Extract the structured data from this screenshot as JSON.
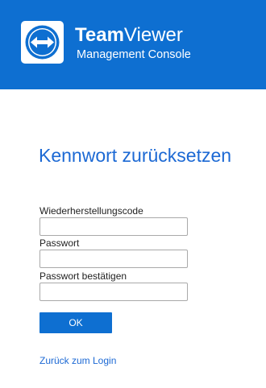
{
  "header": {
    "brand_bold": "Team",
    "brand_regular": "Viewer",
    "subtitle": "Management Console",
    "logo_icon": "teamviewer-arrows-icon",
    "background_color": "#0e6fd1"
  },
  "page": {
    "title": "Kennwort zurücksetzen"
  },
  "form": {
    "recovery_code_label": "Wiederherstellungscode",
    "recovery_code_value": "",
    "password_label": "Passwort",
    "password_value": "",
    "confirm_password_label": "Passwort bestätigen",
    "confirm_password_value": "",
    "ok_label": "OK"
  },
  "links": {
    "back_to_login": "Zurück zum Login"
  },
  "colors": {
    "accent": "#0e6fd1",
    "link": "#1c69d4"
  }
}
